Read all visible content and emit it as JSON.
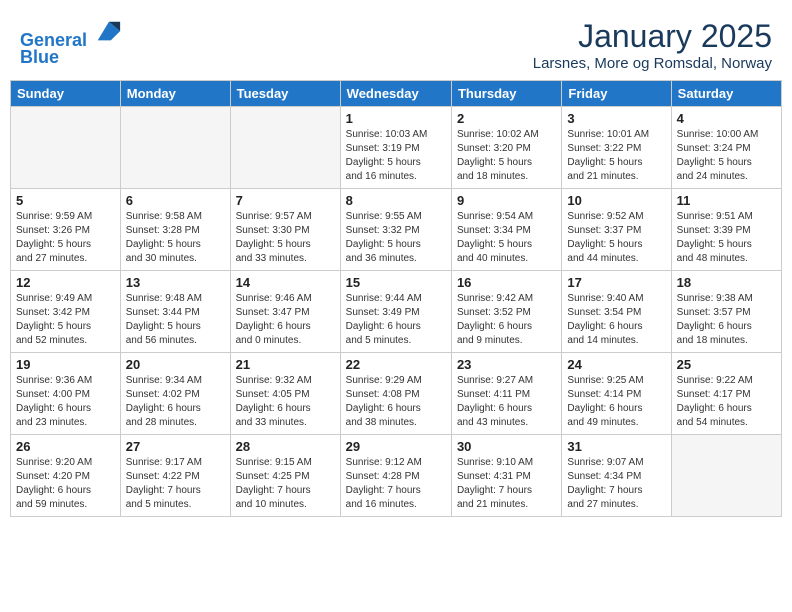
{
  "header": {
    "logo_line1": "General",
    "logo_line2": "Blue",
    "month_title": "January 2025",
    "location": "Larsnes, More og Romsdal, Norway"
  },
  "weekdays": [
    "Sunday",
    "Monday",
    "Tuesday",
    "Wednesday",
    "Thursday",
    "Friday",
    "Saturday"
  ],
  "weeks": [
    [
      {
        "day": "",
        "info": ""
      },
      {
        "day": "",
        "info": ""
      },
      {
        "day": "",
        "info": ""
      },
      {
        "day": "1",
        "info": "Sunrise: 10:03 AM\nSunset: 3:19 PM\nDaylight: 5 hours\nand 16 minutes."
      },
      {
        "day": "2",
        "info": "Sunrise: 10:02 AM\nSunset: 3:20 PM\nDaylight: 5 hours\nand 18 minutes."
      },
      {
        "day": "3",
        "info": "Sunrise: 10:01 AM\nSunset: 3:22 PM\nDaylight: 5 hours\nand 21 minutes."
      },
      {
        "day": "4",
        "info": "Sunrise: 10:00 AM\nSunset: 3:24 PM\nDaylight: 5 hours\nand 24 minutes."
      }
    ],
    [
      {
        "day": "5",
        "info": "Sunrise: 9:59 AM\nSunset: 3:26 PM\nDaylight: 5 hours\nand 27 minutes."
      },
      {
        "day": "6",
        "info": "Sunrise: 9:58 AM\nSunset: 3:28 PM\nDaylight: 5 hours\nand 30 minutes."
      },
      {
        "day": "7",
        "info": "Sunrise: 9:57 AM\nSunset: 3:30 PM\nDaylight: 5 hours\nand 33 minutes."
      },
      {
        "day": "8",
        "info": "Sunrise: 9:55 AM\nSunset: 3:32 PM\nDaylight: 5 hours\nand 36 minutes."
      },
      {
        "day": "9",
        "info": "Sunrise: 9:54 AM\nSunset: 3:34 PM\nDaylight: 5 hours\nand 40 minutes."
      },
      {
        "day": "10",
        "info": "Sunrise: 9:52 AM\nSunset: 3:37 PM\nDaylight: 5 hours\nand 44 minutes."
      },
      {
        "day": "11",
        "info": "Sunrise: 9:51 AM\nSunset: 3:39 PM\nDaylight: 5 hours\nand 48 minutes."
      }
    ],
    [
      {
        "day": "12",
        "info": "Sunrise: 9:49 AM\nSunset: 3:42 PM\nDaylight: 5 hours\nand 52 minutes."
      },
      {
        "day": "13",
        "info": "Sunrise: 9:48 AM\nSunset: 3:44 PM\nDaylight: 5 hours\nand 56 minutes."
      },
      {
        "day": "14",
        "info": "Sunrise: 9:46 AM\nSunset: 3:47 PM\nDaylight: 6 hours\nand 0 minutes."
      },
      {
        "day": "15",
        "info": "Sunrise: 9:44 AM\nSunset: 3:49 PM\nDaylight: 6 hours\nand 5 minutes."
      },
      {
        "day": "16",
        "info": "Sunrise: 9:42 AM\nSunset: 3:52 PM\nDaylight: 6 hours\nand 9 minutes."
      },
      {
        "day": "17",
        "info": "Sunrise: 9:40 AM\nSunset: 3:54 PM\nDaylight: 6 hours\nand 14 minutes."
      },
      {
        "day": "18",
        "info": "Sunrise: 9:38 AM\nSunset: 3:57 PM\nDaylight: 6 hours\nand 18 minutes."
      }
    ],
    [
      {
        "day": "19",
        "info": "Sunrise: 9:36 AM\nSunset: 4:00 PM\nDaylight: 6 hours\nand 23 minutes."
      },
      {
        "day": "20",
        "info": "Sunrise: 9:34 AM\nSunset: 4:02 PM\nDaylight: 6 hours\nand 28 minutes."
      },
      {
        "day": "21",
        "info": "Sunrise: 9:32 AM\nSunset: 4:05 PM\nDaylight: 6 hours\nand 33 minutes."
      },
      {
        "day": "22",
        "info": "Sunrise: 9:29 AM\nSunset: 4:08 PM\nDaylight: 6 hours\nand 38 minutes."
      },
      {
        "day": "23",
        "info": "Sunrise: 9:27 AM\nSunset: 4:11 PM\nDaylight: 6 hours\nand 43 minutes."
      },
      {
        "day": "24",
        "info": "Sunrise: 9:25 AM\nSunset: 4:14 PM\nDaylight: 6 hours\nand 49 minutes."
      },
      {
        "day": "25",
        "info": "Sunrise: 9:22 AM\nSunset: 4:17 PM\nDaylight: 6 hours\nand 54 minutes."
      }
    ],
    [
      {
        "day": "26",
        "info": "Sunrise: 9:20 AM\nSunset: 4:20 PM\nDaylight: 6 hours\nand 59 minutes."
      },
      {
        "day": "27",
        "info": "Sunrise: 9:17 AM\nSunset: 4:22 PM\nDaylight: 7 hours\nand 5 minutes."
      },
      {
        "day": "28",
        "info": "Sunrise: 9:15 AM\nSunset: 4:25 PM\nDaylight: 7 hours\nand 10 minutes."
      },
      {
        "day": "29",
        "info": "Sunrise: 9:12 AM\nSunset: 4:28 PM\nDaylight: 7 hours\nand 16 minutes."
      },
      {
        "day": "30",
        "info": "Sunrise: 9:10 AM\nSunset: 4:31 PM\nDaylight: 7 hours\nand 21 minutes."
      },
      {
        "day": "31",
        "info": "Sunrise: 9:07 AM\nSunset: 4:34 PM\nDaylight: 7 hours\nand 27 minutes."
      },
      {
        "day": "",
        "info": ""
      }
    ]
  ]
}
